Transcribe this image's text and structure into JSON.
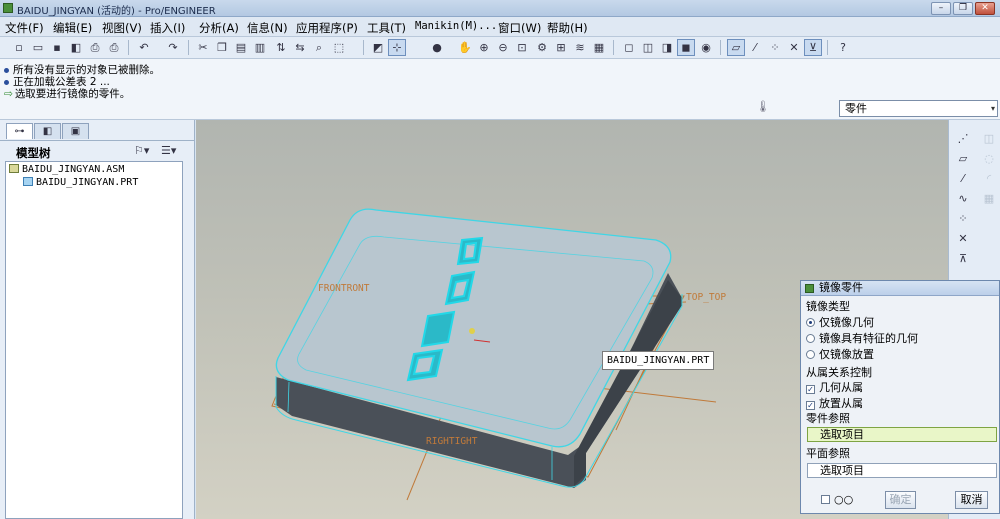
{
  "window": {
    "title": "BAIDU_JINGYAN (活动的) - Pro/ENGINEER",
    "controls": [
      "minimize",
      "maximize",
      "close"
    ]
  },
  "menu": {
    "items": [
      "文件(F)",
      "编辑(E)",
      "视图(V)",
      "插入(I)",
      "分析(A)",
      "信息(N)",
      "应用程序(P)",
      "工具(T)",
      "Manikin(M)...",
      "窗口(W)",
      "帮助(H)"
    ]
  },
  "toolbar": {
    "icons": [
      "new-icon",
      "open-icon",
      "save-icon",
      "save-copy-icon",
      "print-icon",
      "print-alt-icon",
      "undo-icon",
      "redo-icon",
      "cut-icon",
      "copy-icon",
      "paste-icon",
      "paste-special-icon",
      "regenerate-icon",
      "manager-icon",
      "find-icon",
      "select-box-icon",
      "refit-icon",
      "datum-display-icon",
      "shading-icon",
      "spin-icon",
      "zoom-in-icon",
      "zoom-out-icon",
      "zoom-window-icon",
      "view-manager-icon",
      "saved-views-icon",
      "layers-icon",
      "wireframe-icon",
      "hidden-line-icon",
      "no-hidden-icon",
      "shaded-icon",
      "appearance-icon",
      "datum-planes-icon",
      "datum-axes-icon",
      "datum-points-icon",
      "coordinate-systems-icon",
      "context-help-icon"
    ]
  },
  "messages": [
    {
      "marker": "info",
      "text": "所有没有显示的对象已被删除。"
    },
    {
      "marker": "info",
      "text": "正在加载公差表 2 ..."
    },
    {
      "marker": "prompt",
      "text": "选取要进行镜像的零件。"
    }
  ],
  "selection_filter": {
    "value": "零件"
  },
  "model_tree": {
    "title": "模型树",
    "tabs": [
      "model-tree-tab",
      "layer-tab",
      "folder-tab"
    ],
    "nodes": [
      {
        "label": "BAIDU_JINGYAN.ASM",
        "type": "asm",
        "level": 0
      },
      {
        "label": "BAIDU_JINGYAN.PRT",
        "type": "prt",
        "level": 1
      }
    ]
  },
  "viewport": {
    "datum_labels": {
      "front": "FRONTRONT",
      "top": "TOP_TOP",
      "right": "RIGHTIGHT"
    },
    "hover_callout": "BAIDU_JINGYAN.PRT"
  },
  "right_toolbar": {
    "icons": [
      "datum-plane-icon",
      "parallelogram-icon",
      "datum-axis-icon",
      "sketch-curve-icon",
      "datum-point-icon",
      "csys-icon",
      "analysis-icon"
    ]
  },
  "mirror_dialog": {
    "title": "镜像零件",
    "mirror_type_label": "镜像类型",
    "options": [
      {
        "label": "仅镜像几何",
        "selected": true
      },
      {
        "label": "镜像具有特征的几何",
        "selected": false
      },
      {
        "label": "仅镜像放置",
        "selected": false
      }
    ],
    "dependency_label": "从属关系控制",
    "checks": [
      {
        "label": "几何从属",
        "checked": true
      },
      {
        "label": "放置从属",
        "checked": true
      }
    ],
    "part_ref_label": "零件参照",
    "part_ref_value": "选取项目",
    "plane_ref_label": "平面参照",
    "plane_ref_value": "选取项目",
    "preview_icon": "glasses-icon",
    "ok_label": "确定",
    "cancel_label": "取消"
  },
  "colors": {
    "model_edge": "#3fd6e6",
    "model_face": "#b6c4cc",
    "model_side": "#4a5058",
    "datum": "#c07a3a"
  }
}
